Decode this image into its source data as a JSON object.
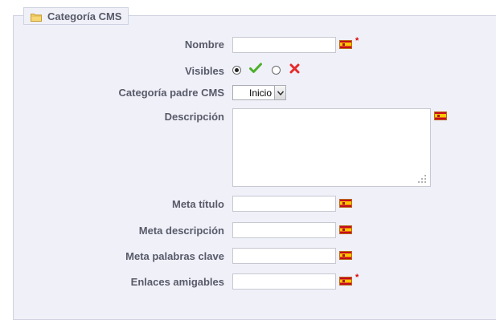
{
  "section": {
    "legend": "Categoría CMS",
    "legend_icon": "folder-icon"
  },
  "fields": {
    "nombre": {
      "label": "Nombre",
      "value": "",
      "required": "*",
      "flag": "spain-flag-icon"
    },
    "visibles": {
      "label": "Visibles",
      "selected": "yes",
      "yes_icon": "check-icon",
      "no_icon": "cross-icon",
      "yes_color": "#4caf2a",
      "no_color": "#e52b2b"
    },
    "categoria_padre": {
      "label": "Categoría padre CMS",
      "value": "Inicio"
    },
    "descripcion": {
      "label": "Descripción",
      "value": "",
      "flag": "spain-flag-icon"
    },
    "meta_titulo": {
      "label": "Meta título",
      "value": "",
      "flag": "spain-flag-icon"
    },
    "meta_descripcion": {
      "label": "Meta descripción",
      "value": "",
      "flag": "spain-flag-icon"
    },
    "meta_palabras": {
      "label": "Meta palabras clave",
      "value": "",
      "flag": "spain-flag-icon"
    },
    "enlaces": {
      "label": "Enlaces amigables",
      "value": "",
      "required": "*",
      "flag": "spain-flag-icon"
    }
  },
  "colors": {
    "panel_bg": "#eff0f8",
    "label_text": "#585a69",
    "required": "#dd0000"
  }
}
